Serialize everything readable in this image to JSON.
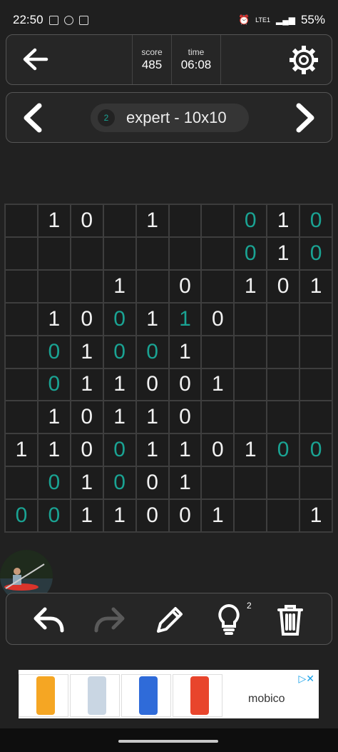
{
  "status": {
    "time": "22:50",
    "battery": "55%",
    "network": "LTE1"
  },
  "header": {
    "score_label": "score",
    "score": "485",
    "time_label": "time",
    "time": "06:08"
  },
  "level": {
    "badge": "2",
    "title": "expert - 10x10"
  },
  "grid": [
    [
      [
        "",
        ""
      ],
      [
        "1",
        ""
      ],
      [
        "0",
        ""
      ],
      [
        "",
        ""
      ],
      [
        "1",
        ""
      ],
      [
        "",
        ""
      ],
      [
        "",
        ""
      ],
      [
        "0",
        "t"
      ],
      [
        "1",
        ""
      ],
      [
        "0",
        "t"
      ]
    ],
    [
      [
        "",
        ""
      ],
      [
        "",
        ""
      ],
      [
        "",
        ""
      ],
      [
        "",
        ""
      ],
      [
        "",
        ""
      ],
      [
        "",
        ""
      ],
      [
        "",
        ""
      ],
      [
        "0",
        "t"
      ],
      [
        "1",
        ""
      ],
      [
        "0",
        "t"
      ]
    ],
    [
      [
        "",
        ""
      ],
      [
        "",
        ""
      ],
      [
        "",
        ""
      ],
      [
        "1",
        ""
      ],
      [
        "",
        ""
      ],
      [
        "0",
        ""
      ],
      [
        "",
        ""
      ],
      [
        "1",
        ""
      ],
      [
        "0",
        ""
      ],
      [
        "1",
        ""
      ]
    ],
    [
      [
        "",
        ""
      ],
      [
        "1",
        ""
      ],
      [
        "0",
        ""
      ],
      [
        "0",
        "t"
      ],
      [
        "1",
        ""
      ],
      [
        "1",
        "t"
      ],
      [
        "0",
        ""
      ],
      [
        "",
        ""
      ],
      [
        "",
        ""
      ],
      [
        "",
        ""
      ]
    ],
    [
      [
        "",
        ""
      ],
      [
        "0",
        "t"
      ],
      [
        "1",
        ""
      ],
      [
        "0",
        "t"
      ],
      [
        "0",
        "t"
      ],
      [
        "1",
        ""
      ],
      [
        "",
        ""
      ],
      [
        "",
        ""
      ],
      [
        "",
        ""
      ],
      [
        "",
        ""
      ]
    ],
    [
      [
        "",
        ""
      ],
      [
        "0",
        "t"
      ],
      [
        "1",
        ""
      ],
      [
        "1",
        ""
      ],
      [
        "0",
        ""
      ],
      [
        "0",
        ""
      ],
      [
        "1",
        ""
      ],
      [
        "",
        ""
      ],
      [
        "",
        ""
      ],
      [
        "",
        ""
      ]
    ],
    [
      [
        "",
        ""
      ],
      [
        "1",
        ""
      ],
      [
        "0",
        ""
      ],
      [
        "1",
        ""
      ],
      [
        "1",
        ""
      ],
      [
        "0",
        ""
      ],
      [
        "",
        ""
      ],
      [
        "",
        ""
      ],
      [
        "",
        ""
      ],
      [
        "",
        ""
      ]
    ],
    [
      [
        "1",
        ""
      ],
      [
        "1",
        ""
      ],
      [
        "0",
        ""
      ],
      [
        "0",
        "t"
      ],
      [
        "1",
        ""
      ],
      [
        "1",
        ""
      ],
      [
        "0",
        ""
      ],
      [
        "1",
        ""
      ],
      [
        "0",
        "t"
      ],
      [
        "0",
        "t"
      ]
    ],
    [
      [
        "",
        ""
      ],
      [
        "0",
        "t"
      ],
      [
        "1",
        ""
      ],
      [
        "0",
        "t"
      ],
      [
        "0",
        ""
      ],
      [
        "1",
        ""
      ],
      [
        "",
        ""
      ],
      [
        "",
        ""
      ],
      [
        "",
        ""
      ],
      [
        "",
        ""
      ]
    ],
    [
      [
        "0",
        "t"
      ],
      [
        "0",
        "t"
      ],
      [
        "1",
        ""
      ],
      [
        "1",
        ""
      ],
      [
        "0",
        ""
      ],
      [
        "0",
        ""
      ],
      [
        "1",
        ""
      ],
      [
        "",
        ""
      ],
      [
        "",
        ""
      ],
      [
        "1",
        ""
      ]
    ]
  ],
  "toolbar": {
    "hint_count": "2"
  },
  "ad": {
    "brand": "mobico",
    "phone_colors": [
      "#f5a623",
      "#c9d6e3",
      "#2f6bd9",
      "#e8452c"
    ]
  },
  "colors": {
    "accent": "#1aa393",
    "panel": "#262626",
    "background": "#212121"
  }
}
